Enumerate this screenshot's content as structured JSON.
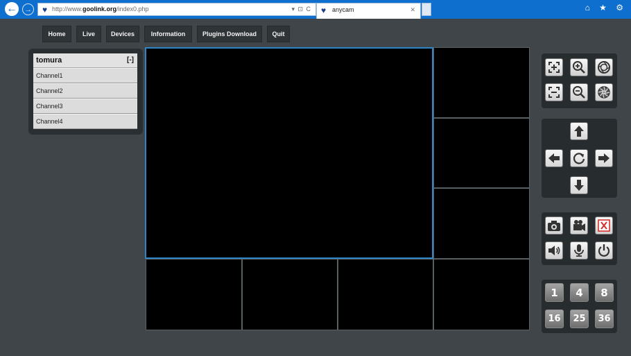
{
  "browser": {
    "address_prefix": "http://www.",
    "address_domain": "goolink.org",
    "address_path": "/index0.php",
    "address_controls": "▾ ⊡ C",
    "tab_title": "anycam",
    "tab_close": "✕",
    "back_glyph": "←",
    "forward_glyph": "→",
    "tools_glyphs": "⌂ ★ ⚙",
    "favicon": "heart-shield-icon"
  },
  "menu": {
    "items": [
      "Home",
      "Live",
      "Devices",
      "Information",
      "Plugins Download",
      "Quit"
    ]
  },
  "device_tree": {
    "device_name": "tomura",
    "collapse_toggle": "[-]",
    "channels": [
      "Channel1",
      "Channel2",
      "Channel3",
      "Channel4"
    ]
  },
  "controls": {
    "zoom_focus_iris": [
      "focus-plus-icon",
      "zoom-in-icon",
      "iris-open-icon",
      "focus-minus-icon",
      "zoom-out-icon",
      "iris-close-icon"
    ],
    "ptz": [
      "up-arrow-icon",
      "left-arrow-icon",
      "refresh-icon",
      "right-arrow-icon",
      "down-arrow-icon"
    ],
    "media": [
      "camera-icon",
      "video-camera-icon",
      "close-video-icon",
      "speaker-icon",
      "microphone-icon",
      "power-icon"
    ],
    "layouts": [
      "1",
      "4",
      "8",
      "16",
      "25",
      "36"
    ]
  },
  "colors": {
    "page_bg": "#3f4548",
    "browser_bar": "#0f6fcf",
    "selected_view_border": "#2e86c8",
    "close_red": "#d3322a"
  }
}
